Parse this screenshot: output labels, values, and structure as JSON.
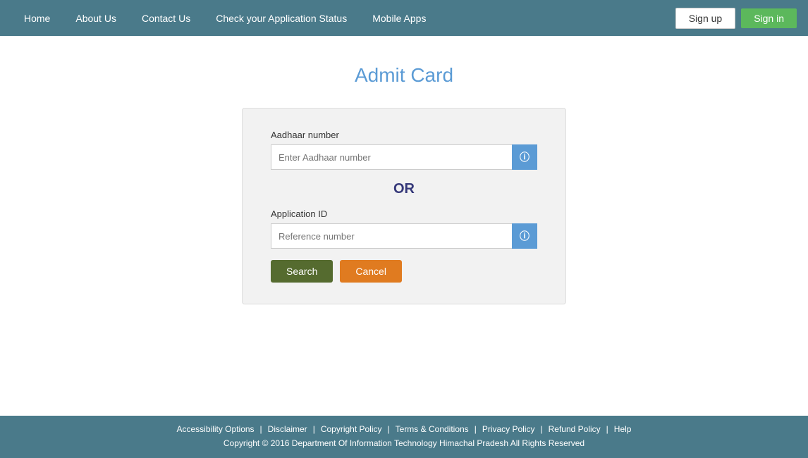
{
  "navbar": {
    "home_label": "Home",
    "about_label": "About Us",
    "contact_label": "Contact Us",
    "check_status_label": "Check your Application Status",
    "mobile_apps_label": "Mobile Apps",
    "signup_label": "Sign up",
    "signin_label": "Sign in"
  },
  "main": {
    "page_title": "Admit Card",
    "aadhaar_label": "Aadhaar number",
    "aadhaar_placeholder": "Enter Aadhaar number",
    "or_text": "OR",
    "app_id_label": "Application ID",
    "app_id_placeholder": "Reference number",
    "search_label": "Search",
    "cancel_label": "Cancel"
  },
  "footer": {
    "accessibility_label": "Accessibility Options",
    "disclaimer_label": "Disclaimer",
    "copyright_policy_label": "Copyright Policy",
    "terms_label": "Terms & Conditions",
    "privacy_label": "Privacy Policy",
    "refund_label": "Refund Policy",
    "help_label": "Help",
    "copyright_text": "Copyright © 2016 Department Of Information Technology Himachal Pradesh All Rights Reserved"
  }
}
